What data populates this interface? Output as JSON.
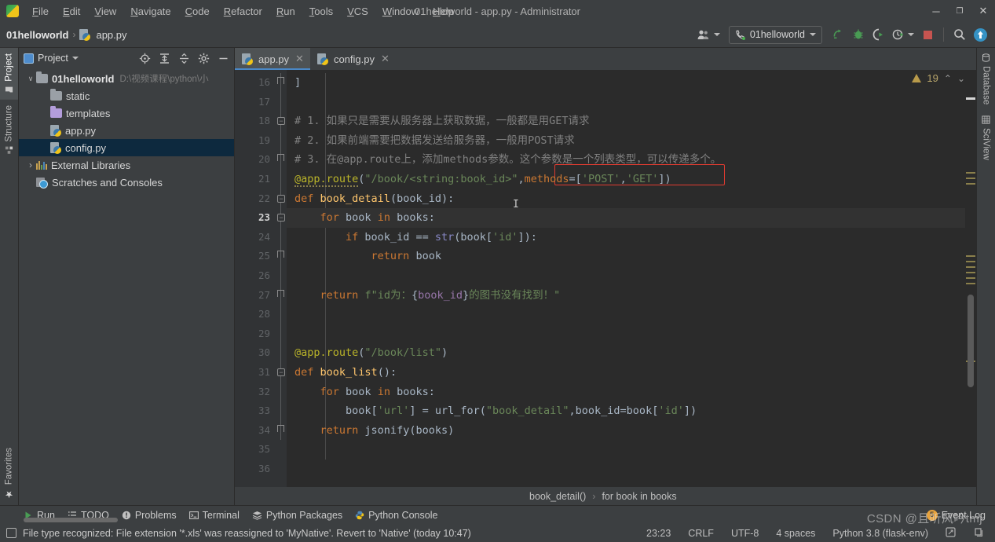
{
  "window": {
    "title": "01helloworld - app.py - Administrator",
    "minimize": "─",
    "maximize": "❐",
    "close": "✕",
    "app_icon": "pycharm-logo-icon"
  },
  "menu": {
    "items": [
      {
        "label": "File"
      },
      {
        "label": "Edit"
      },
      {
        "label": "View"
      },
      {
        "label": "Navigate"
      },
      {
        "label": "Code"
      },
      {
        "label": "Refactor"
      },
      {
        "label": "Run"
      },
      {
        "label": "Tools"
      },
      {
        "label": "VCS"
      },
      {
        "label": "Window"
      },
      {
        "label": "Help"
      }
    ]
  },
  "navbar": {
    "breadcrumb": {
      "project": "01helloworld",
      "separator": "›",
      "file": "app.py"
    },
    "run_config": "01helloworld",
    "toolbar_icons": [
      "user-account-icon",
      "run-icon",
      "debug-icon",
      "run-coverage-icon",
      "profile-icon",
      "stop-icon",
      "search-icon",
      "update-project-icon"
    ]
  },
  "left_rail": {
    "top": [
      {
        "label": "Project",
        "icon": "project-icon",
        "active": true
      },
      {
        "label": "Structure",
        "icon": "structure-icon",
        "active": false
      }
    ],
    "bottom": [
      {
        "label": "Favorites",
        "icon": "star-icon",
        "active": false
      }
    ]
  },
  "right_rail": {
    "items": [
      {
        "label": "Database",
        "icon": "database-icon"
      },
      {
        "label": "SciView",
        "icon": "sciview-icon"
      }
    ]
  },
  "project_panel": {
    "title": "Project",
    "header_icons": [
      "locate-icon",
      "expand-all-icon",
      "collapse-all-icon",
      "settings-gear-icon",
      "hide-icon"
    ],
    "tree": [
      {
        "depth": 0,
        "twisty": "⌄",
        "icon": "folder-icon",
        "name": "01helloworld",
        "bold": true,
        "path": "D:\\视频课程\\python\\小",
        "selected": false
      },
      {
        "depth": 1,
        "twisty": "",
        "icon": "folder-icon",
        "name": "static",
        "bold": false,
        "path": "",
        "selected": false
      },
      {
        "depth": 1,
        "twisty": "",
        "icon": "folder-purple-icon",
        "name": "templates",
        "bold": false,
        "path": "",
        "selected": false
      },
      {
        "depth": 1,
        "twisty": "",
        "icon": "python-file-icon",
        "name": "app.py",
        "bold": false,
        "path": "",
        "selected": false
      },
      {
        "depth": 1,
        "twisty": "",
        "icon": "python-file-icon",
        "name": "config.py",
        "bold": false,
        "path": "",
        "selected": true
      },
      {
        "depth": 0,
        "twisty": "›",
        "icon": "external-libraries-icon",
        "name": "External Libraries",
        "bold": false,
        "path": "",
        "selected": false
      },
      {
        "depth": 0,
        "twisty": "",
        "icon": "scratches-icon",
        "name": "Scratches and Consoles",
        "bold": false,
        "path": "",
        "selected": false
      }
    ]
  },
  "editor": {
    "tabs": [
      {
        "label": "app.py",
        "icon": "python-file-icon",
        "active": true,
        "close": "✕"
      },
      {
        "label": "config.py",
        "icon": "python-file-icon",
        "active": false,
        "close": "✕"
      }
    ],
    "inspection": {
      "warning_count": "19",
      "up": "⌃",
      "down": "⌄",
      "icon": "warning-triangle-icon"
    },
    "current_line": 23,
    "first_line": 16,
    "lines": [
      {
        "n": 16,
        "html": "<span class='c-id'>]</span>",
        "fold": "end"
      },
      {
        "n": 17,
        "html": "",
        "fold": "bar"
      },
      {
        "n": 18,
        "html": "<span class='c-cmt'># 1. 如果只是需要从服务器上获取数据，一般都是用GET请求</span>",
        "fold": "minus"
      },
      {
        "n": 19,
        "html": "<span class='c-cmt'># 2. 如果前端需要把数据发送给服务器，一般用POST请求</span>",
        "fold": "bar"
      },
      {
        "n": 20,
        "html": "<span class='c-cmt'># 3. 在@app.route上，添加methods参数。这个参数是一个列表类型，可以传递多个。</span>",
        "fold": "end"
      },
      {
        "n": 21,
        "html": "<span class='c-dec sq-under'>@app.route</span><span class='c-id'>(</span><span class='c-str'>\"/book/&lt;string:book_id&gt;\"</span><span class='c-id'>,</span><span class='c-kw'>methods</span><span class='c-id'>=[</span><span class='c-str'>'POST'</span><span class='c-id'>,</span><span class='c-str'>'GET'</span><span class='c-id'>])</span>",
        "fold": "bar"
      },
      {
        "n": 22,
        "html": "<span class='c-kw'>def</span> <span class='c-fn'>book_detail</span><span class='c-id'>(book_id):</span>",
        "fold": "minus"
      },
      {
        "n": 23,
        "html": "    <span class='c-kw'>for</span> book <span class='c-kw'>in</span> books:",
        "fold": "minus"
      },
      {
        "n": 24,
        "html": "        <span class='c-kw'>if</span> book_id == <span class='c-builtin'>str</span>(book[<span class='c-str'>'id'</span>]):",
        "fold": "bar"
      },
      {
        "n": 25,
        "html": "            <span class='c-kw'>return</span> book",
        "fold": "end"
      },
      {
        "n": 26,
        "html": "",
        "fold": "bar"
      },
      {
        "n": 27,
        "html": "    <span class='c-kw'>return</span> <span class='c-str'>f\"id为：</span><span class='c-id'>{</span><span class='c-hl'>book_id</span><span class='c-id'>}</span><span class='c-str'>的图书没有找到！\"</span>",
        "fold": "end"
      },
      {
        "n": 28,
        "html": "",
        "fold": "bar"
      },
      {
        "n": 29,
        "html": "",
        "fold": "bar"
      },
      {
        "n": 30,
        "html": "<span class='c-dec'>@app.route</span><span class='c-id'>(</span><span class='c-str'>\"/book/list\"</span><span class='c-id'>)</span>",
        "fold": "bar"
      },
      {
        "n": 31,
        "html": "<span class='c-kw'>def</span> <span class='c-fn'>book_list</span><span class='c-id'>():</span>",
        "fold": "minus"
      },
      {
        "n": 32,
        "html": "    <span class='c-kw'>for</span> book <span class='c-kw'>in</span> books:",
        "fold": "bar"
      },
      {
        "n": 33,
        "html": "        book[<span class='c-str'>'url'</span>] = url_for(<span class='c-str'>\"book_detail\"</span>,book_id=book[<span class='c-str'>'id'</span>])",
        "fold": "bar"
      },
      {
        "n": 34,
        "html": "    <span class='c-kw'>return</span> jsonify(books)",
        "fold": "end"
      },
      {
        "n": 35,
        "html": "",
        "fold": "none"
      },
      {
        "n": 36,
        "html": "",
        "fold": "none"
      }
    ],
    "breadcrumbs": [
      {
        "label": "book_detail()"
      },
      {
        "label": "for book in books"
      }
    ],
    "breadcrumb_separator": "›"
  },
  "bottom_bar": {
    "items": [
      {
        "label": "Run",
        "icon": "run-icon"
      },
      {
        "label": "TODO",
        "icon": "todo-icon"
      },
      {
        "label": "Problems",
        "icon": "problems-icon"
      },
      {
        "label": "Terminal",
        "icon": "terminal-icon"
      },
      {
        "label": "Python Packages",
        "icon": "packages-icon"
      },
      {
        "label": "Python Console",
        "icon": "python-console-icon"
      }
    ],
    "event_log": {
      "label": "Event Log",
      "count": "5"
    }
  },
  "status_bar": {
    "message": "File type recognized: File extension '*.xls' was reassigned to 'MyNative'. Revert to 'Native' (today 10:47)",
    "message_icon": "file-type-icon",
    "caret_position": "23:23",
    "line_separator": "CRLF",
    "encoding": "UTF-8",
    "indent": "4 spaces",
    "interpreter": "Python 3.8 (flask-env)",
    "right_icons": [
      "git-branch-icon",
      "notifications-icon"
    ]
  },
  "watermark": "CSDN @且听风吟tmj",
  "colors": {
    "window_bg": "#3c3f41",
    "editor_bg": "#2b2b2b",
    "gutter_bg": "#313335",
    "selection": "#0d293e",
    "accent": "#4a88c7",
    "keyword": "#cc7832",
    "string": "#6a8759",
    "function": "#ffc66d",
    "decorator": "#bbb529",
    "comment": "#808080",
    "warning": "#b89a4a",
    "error_box": "#e03b30",
    "run_green": "#499c54",
    "stop_red": "#c75450"
  }
}
